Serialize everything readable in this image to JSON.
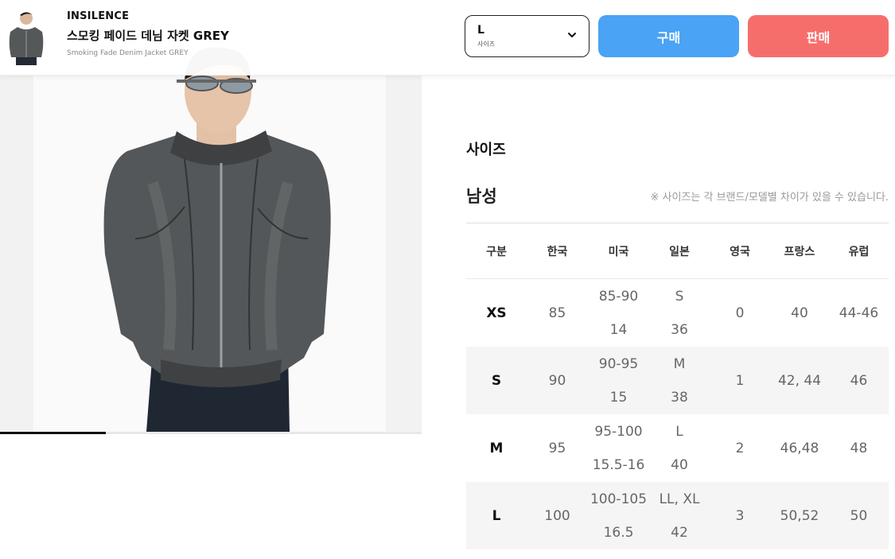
{
  "header": {
    "brand": "INSILENCE",
    "product_name_ko": "스모킹 페이드 데님 자켓 GREY",
    "product_name_en": "Smoking Fade Denim Jacket GREY",
    "size_selector": {
      "value": "L",
      "label": "사이즈"
    },
    "buy_label": "구매",
    "sell_label": "판매"
  },
  "gallery": {
    "progress": 0.25
  },
  "size_section": {
    "title": "사이즈",
    "gender": "남성",
    "notice": "※ 사이즈는 각 브랜드/모델별 차이가 있을 수 있습니다.",
    "columns": [
      "구분",
      "한국",
      "미국",
      "일본",
      "영국",
      "프랑스",
      "유럽"
    ],
    "rows": [
      {
        "size": "XS",
        "kr": "85",
        "us": [
          "85-90",
          "14"
        ],
        "jp": [
          "S",
          "36"
        ],
        "uk": "0",
        "fr": "40",
        "eu": "44-46"
      },
      {
        "size": "S",
        "kr": "90",
        "us": [
          "90-95",
          "15"
        ],
        "jp": [
          "M",
          "38"
        ],
        "uk": "1",
        "fr": "42, 44",
        "eu": "46"
      },
      {
        "size": "M",
        "kr": "95",
        "us": [
          "95-100",
          "15.5-16"
        ],
        "jp": [
          "L",
          "40"
        ],
        "uk": "2",
        "fr": "46,48",
        "eu": "48"
      },
      {
        "size": "L",
        "kr": "100",
        "us": [
          "100-105",
          "16.5"
        ],
        "jp": [
          "LL, XL",
          "42"
        ],
        "uk": "3",
        "fr": "50,52",
        "eu": "50"
      }
    ]
  },
  "colors": {
    "buy": "#4aa3f5",
    "sell": "#f66e6c",
    "jacket": "#4f5153"
  }
}
